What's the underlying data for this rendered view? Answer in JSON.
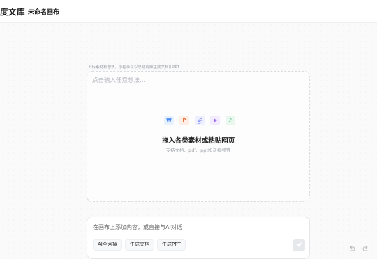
{
  "header": {
    "app_title": "度文库",
    "canvas_name": "未命名画布"
  },
  "upload": {
    "hint": "上传素材和想法，小稻李可以总结视频生成文档和PPT",
    "placeholder": "点击输入任意想法...",
    "title": "拖入各类素材或粘贴网页",
    "subtitle": "支持文档、pdf、ppt和音视频等",
    "icons": [
      "word-icon",
      "ppt-icon",
      "link-icon",
      "video-icon",
      "music-icon"
    ],
    "icon_glyphs": {
      "word": "W",
      "ppt": "P",
      "link": "🔗",
      "video": "▶",
      "music": "♪"
    }
  },
  "chat": {
    "placeholder": "在画布上添加内容，或直接与AI对话",
    "chips": [
      "AI全网搜",
      "生成文档",
      "生成PPT"
    ]
  },
  "colors": {
    "word": "#3b82f6",
    "ppt": "#f0703a",
    "link": "#6b7cf5",
    "video": "#9b6cf0",
    "music": "#35b46a"
  }
}
